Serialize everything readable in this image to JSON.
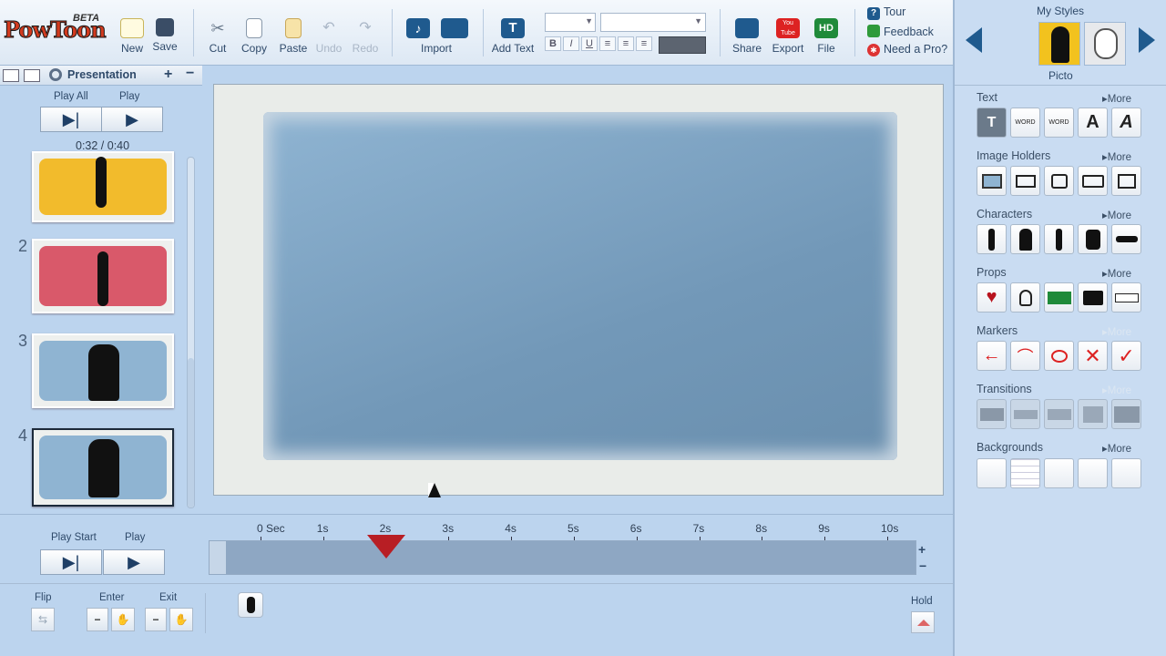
{
  "app": {
    "logo": "PowToon",
    "beta": "BETA"
  },
  "toolbar": {
    "new": "New",
    "save": "Save",
    "cut": "Cut",
    "copy": "Copy",
    "paste": "Paste",
    "undo": "Undo",
    "redo": "Redo",
    "import": "Import",
    "add_text": "Add Text",
    "share": "Share",
    "export": "Export",
    "file": "File",
    "file_badge": "HD",
    "export_badge": "You Tube",
    "tour": "Tour",
    "feedback": "Feedback",
    "need_pro": "Need a Pro?",
    "bold": "B",
    "italic": "I",
    "underline": "U"
  },
  "left": {
    "tab": "Presentation",
    "play_all": "Play All",
    "play": "Play",
    "time": "0:32 / 0:40",
    "slides": [
      {
        "num": "",
        "color": "#f2bb2c"
      },
      {
        "num": "2",
        "color": "#d9596a"
      },
      {
        "num": "3",
        "color": "#8fb4d2"
      },
      {
        "num": "4",
        "color": "#8fb4d2"
      }
    ]
  },
  "right": {
    "header": "My Styles",
    "style_name": "Picto",
    "sections": [
      {
        "title": "Text",
        "more": "More"
      },
      {
        "title": "Image Holders",
        "more": "More"
      },
      {
        "title": "Characters",
        "more": "More"
      },
      {
        "title": "Props",
        "more": "More"
      },
      {
        "title": "Markers",
        "more": "More"
      },
      {
        "title": "Transitions",
        "more": "More"
      },
      {
        "title": "Backgrounds",
        "more": "More"
      }
    ],
    "text_tiles": [
      "T",
      "WORD",
      "WORD",
      "A",
      "A"
    ],
    "bg_colors": [
      "#f4f4f4",
      "#ffffff",
      "#f2b51e",
      "#e23a3a",
      "#7a9ec2"
    ]
  },
  "timeline": {
    "play_start": "Play Start",
    "play": "Play",
    "ticks": [
      "0 Sec",
      "1s",
      "2s",
      "3s",
      "4s",
      "5s",
      "6s",
      "7s",
      "8s",
      "9s",
      "10s"
    ],
    "playhead_sec": 2,
    "flip": "Flip",
    "enter": "Enter",
    "exit": "Exit",
    "hold": "Hold"
  }
}
